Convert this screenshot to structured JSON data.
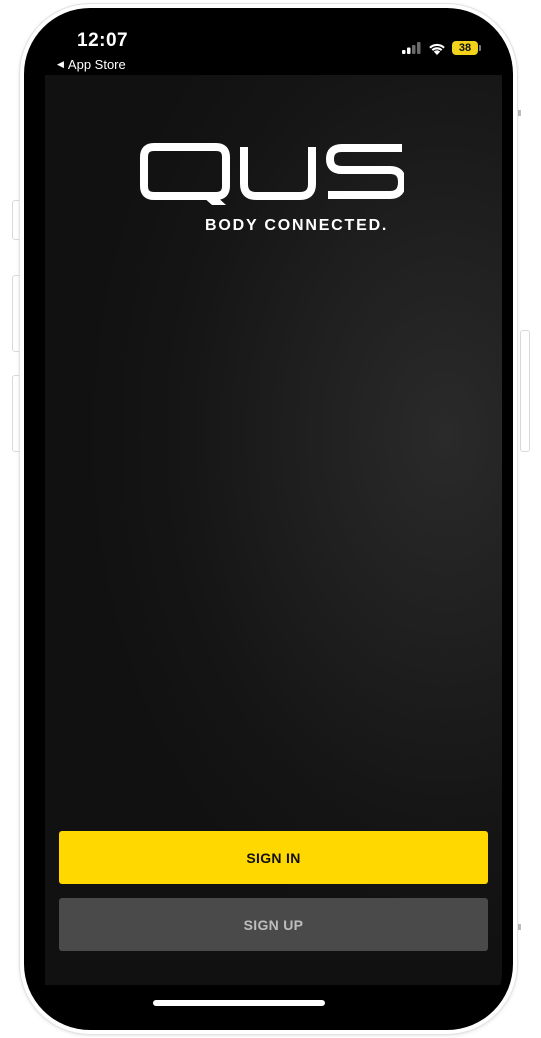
{
  "status_bar": {
    "time": "12:07",
    "back_label": "App Store",
    "battery_level": "38"
  },
  "brand": {
    "logo_text": "QUS",
    "tagline": "BODY CONNECTED."
  },
  "actions": {
    "sign_in_label": "SIGN IN",
    "sign_up_label": "SIGN UP"
  },
  "colors": {
    "accent": "#ffd800",
    "secondary_button": "#4a4a4a",
    "background": "#1a1a1a",
    "battery": "#f2d21a"
  },
  "icons": [
    "cellular-signal-icon",
    "wifi-icon",
    "battery-icon",
    "back-arrow-icon"
  ]
}
